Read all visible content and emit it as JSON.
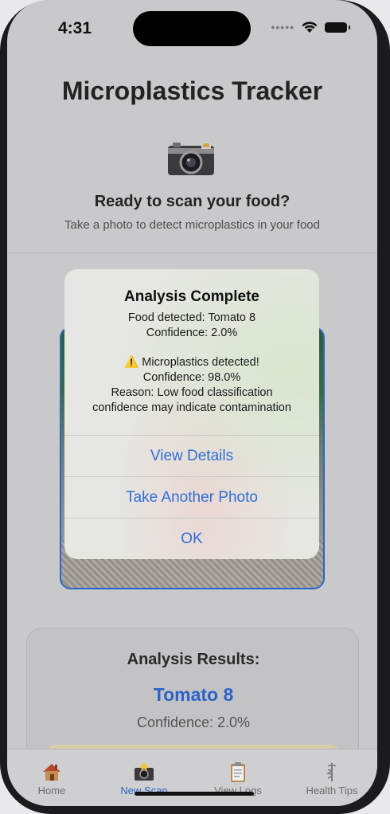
{
  "status": {
    "time": "4:31"
  },
  "app_title": "Microplastics Tracker",
  "scan_prompt": {
    "title": "Ready to scan your food?",
    "subtitle": "Take a photo to detect microplastics in your food"
  },
  "results": {
    "heading": "Analysis Results:",
    "food": "Tomato 8",
    "confidence": "Confidence: 2.0%"
  },
  "alert": {
    "title": "Analysis Complete",
    "lines": [
      "Food detected: Tomato 8",
      "Confidence: 2.0%",
      "⚠️ Microplastics detected!",
      "Confidence: 98.0%",
      "Reason: Low food classification",
      "confidence may indicate contamination"
    ],
    "buttons": [
      "View Details",
      "Take Another Photo",
      "OK"
    ]
  },
  "tabs": [
    {
      "label": "Home",
      "icon": "house-icon"
    },
    {
      "label": "New Scan",
      "icon": "camera-flash-icon",
      "active": true
    },
    {
      "label": "View Logs",
      "icon": "clipboard-icon"
    },
    {
      "label": "Health Tips",
      "icon": "caduceus-icon"
    }
  ],
  "colors": {
    "accent": "#2d63c8",
    "alert_button": "#2f6fd6"
  }
}
